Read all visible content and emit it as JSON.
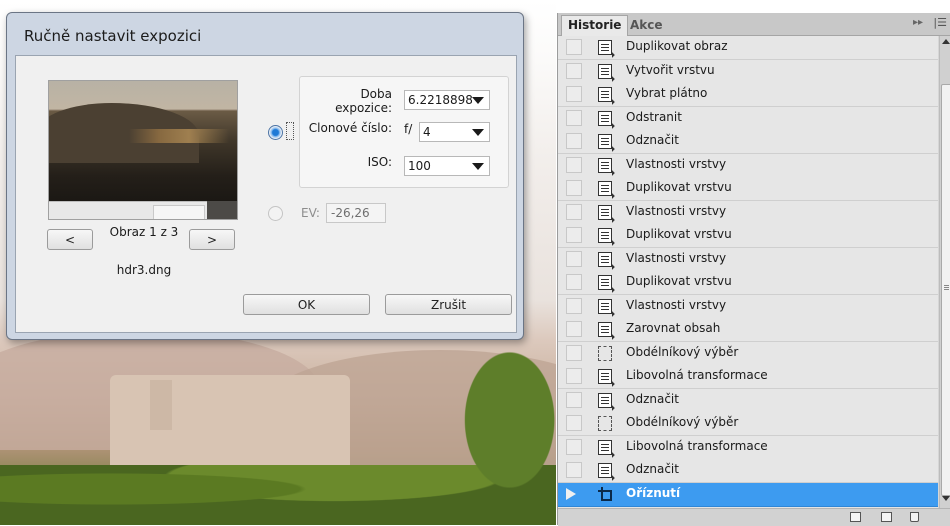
{
  "dialog": {
    "title": "Ručně nastavit expozici",
    "nav": {
      "prev": "<",
      "next": ">",
      "counter": "Obraz 1 z 3",
      "filename": "hdr3.dng"
    },
    "exposure_time": {
      "label": "Doba expozice:",
      "value": "6.2218898"
    },
    "aperture": {
      "label": "Clonové číslo:",
      "prefix": "f/",
      "value": "4"
    },
    "iso": {
      "label": "ISO:",
      "value": "100"
    },
    "ev": {
      "label": "EV:",
      "value": "-26,26"
    },
    "ok": "OK",
    "cancel": "Zrušit"
  },
  "panel": {
    "tabs": [
      "Historie",
      "Akce"
    ],
    "history": [
      {
        "label": "Duplikovat obraz",
        "icon": "doc-icon"
      },
      {
        "label": "Vytvořit vrstvu",
        "icon": "doc-icon"
      },
      {
        "label": "Vybrat plátno",
        "icon": "doc-icon"
      },
      {
        "label": "Odstranit",
        "icon": "doc-icon"
      },
      {
        "label": "Odznačit",
        "icon": "doc-icon"
      },
      {
        "label": "Vlastnosti vrstvy",
        "icon": "doc-icon"
      },
      {
        "label": "Duplikovat vrstvu",
        "icon": "doc-icon"
      },
      {
        "label": "Vlastnosti vrstvy",
        "icon": "doc-icon"
      },
      {
        "label": "Duplikovat vrstvu",
        "icon": "doc-icon"
      },
      {
        "label": "Vlastnosti vrstvy",
        "icon": "doc-icon"
      },
      {
        "label": "Duplikovat vrstvu",
        "icon": "doc-icon"
      },
      {
        "label": "Vlastnosti vrstvy",
        "icon": "doc-icon"
      },
      {
        "label": "Zarovnat obsah",
        "icon": "doc-icon"
      },
      {
        "label": "Obdélníkový výběr",
        "icon": "marquee-icon"
      },
      {
        "label": "Libovolná transformace",
        "icon": "doc-icon"
      },
      {
        "label": "Odznačit",
        "icon": "doc-icon"
      },
      {
        "label": "Obdélníkový výběr",
        "icon": "marquee-icon"
      },
      {
        "label": "Libovolná transformace",
        "icon": "doc-icon"
      },
      {
        "label": "Odznačit",
        "icon": "doc-icon"
      },
      {
        "label": "Oříznutí",
        "icon": "crop-icon",
        "active": true
      }
    ]
  },
  "colors": {
    "selection": "#3d9bf0",
    "dialog_frame": "#cdd6e3"
  }
}
